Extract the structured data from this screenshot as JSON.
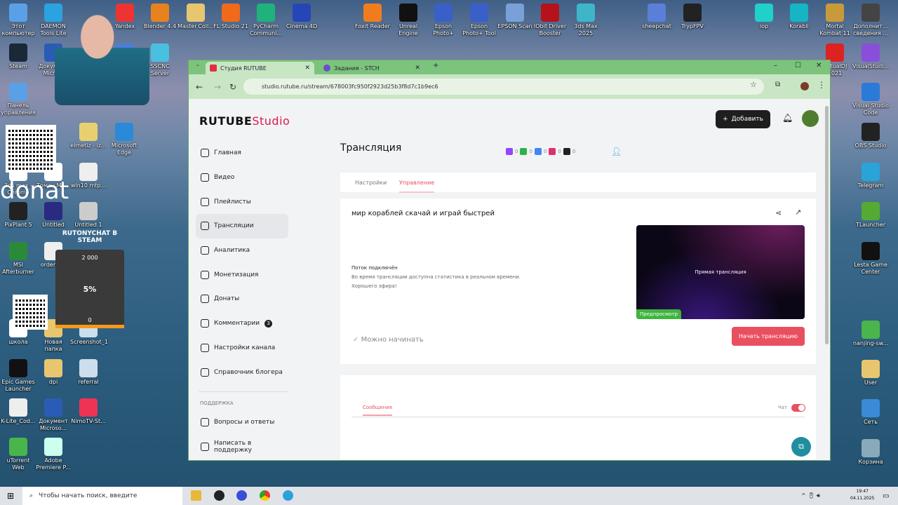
{
  "desktop": {
    "icons": [
      "Этот компьютер",
      "DAEMON Tools Lite",
      "Yandex",
      "Blender 4.4",
      "Master.Coll...",
      "FL Studio 21",
      "PyCharm Communi...",
      "Cinema 4D",
      "Foxit Reader",
      "Unreal Engine",
      "Epson Photo+",
      "Epson Photo+ Tool",
      "EPSON Scan",
      "IObit Driver Booster",
      "3ds Max 2025",
      "sheepchat",
      "TrypFPV",
      "iop",
      "Korabli",
      "Mortal Kombat 11",
      "Дополнит... сведения ...",
      "Steam",
      "Документ Micro...",
      "SSCNC",
      "SSCNC Server",
      "VirtualDJ 2021",
      "VisualStudi...",
      "Панель управления",
      "elmetiz - iz...",
      "Microsoft Edge",
      "win10 mtp...",
      "3ds max - Chrome",
      "Томан Ма...",
      "PixPlant 5",
      "Untitled",
      "Untitled 1",
      "MSI Afterburner",
      "order-3...",
      "школа",
      "Новая папка",
      "Screenshot_1",
      "Epic Games Launcher",
      "dpi",
      "referral",
      "K-Lite_Cod...",
      "Документ Microso...",
      "NimoTV-St...",
      "uTorrent Web",
      "Adobe Premiere P...",
      "Visual Studio Code",
      "OBS Studio",
      "Telegram",
      "TLauncher",
      "Lesta Game Center",
      "nanjing-sw...",
      "User",
      "Сеть",
      "Корзина"
    ],
    "overlay": {
      "donat": "donat",
      "widget_title": "RUTONYCHAT B STEAM",
      "goal": "2 000",
      "percent": "5%",
      "progress_fraction": 0.05,
      "current": "0"
    }
  },
  "browser": {
    "tabs": [
      {
        "label": "Студия RUTUBE",
        "active": true
      },
      {
        "label": "Задания - STCH",
        "active": false
      }
    ],
    "url": "studio.rutube.ru/stream/678003fc950f2923d25b3f8d7c1b9ec6"
  },
  "studio": {
    "logo": "RUTUBE",
    "logo_suffix": "Studio",
    "add_button": "Добавить",
    "sidebar": [
      {
        "label": "Главная"
      },
      {
        "label": "Видео"
      },
      {
        "label": "Плейлисты"
      },
      {
        "label": "Трансляции",
        "selected": true
      },
      {
        "label": "Аналитика"
      },
      {
        "label": "Монетизация"
      },
      {
        "label": "Донаты"
      },
      {
        "label": "Комментарии",
        "badge": "3"
      },
      {
        "label": "Настройки канала"
      },
      {
        "label": "Справочник блогера"
      }
    ],
    "support_header": "ПОДДЕРЖКА",
    "support": [
      {
        "label": "Вопросы и ответы"
      },
      {
        "label": "Написать в поддержку"
      }
    ],
    "page_title": "Трансляция",
    "platform_counts": [
      "0",
      "0",
      "0",
      "0",
      "0"
    ],
    "tabs": [
      "Настройки",
      "Управление"
    ],
    "active_tab": "Управление",
    "stream_title": "мир кораблей скачай и играй быстрей",
    "status_title": "Поток подключён",
    "status_line1": "Во время трансляции доступна статистика в реальном времени.",
    "status_line2": "Хорошего эфира!",
    "preview_text": "Прямая трансляция",
    "preview_badge": "Предпросмотр",
    "ready_text": "Можно начинать",
    "start_button": "Начать трансляцию",
    "messages_tab": "Сообщения",
    "chat_label": "Чат",
    "chat_enabled": true,
    "accent": "#e9505f"
  },
  "taskbar": {
    "search_placeholder": "Чтобы начать поиск, введите",
    "time": "19:47",
    "date": "04.11.2025"
  }
}
